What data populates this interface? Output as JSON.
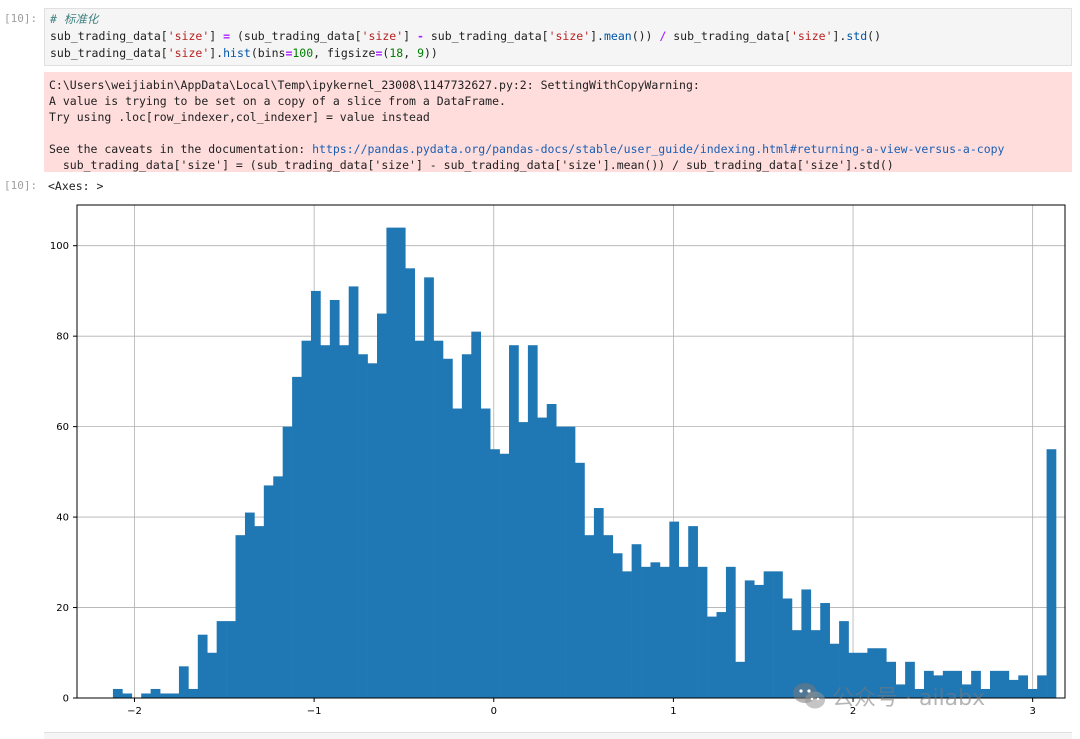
{
  "cell_in": {
    "prompt": "[10]:",
    "comment": "# 标准化",
    "line2": {
      "a": "sub_trading_data[",
      "s1": "'size'",
      "b": "] ",
      "eq": "=",
      "c": " (sub_trading_data[",
      "s2": "'size'",
      "d": "] ",
      "minus": "-",
      "e": " sub_trading_data[",
      "s3": "'size'",
      "f": "].",
      "mean": "mean",
      "g": "()) ",
      "div": "/",
      "h": " sub_trading_data[",
      "s4": "'size'",
      "i": "].",
      "std": "std",
      "j": "()"
    },
    "line3": {
      "a": "sub_trading_data[",
      "s1": "'size'",
      "b": "].",
      "hist": "hist",
      "c": "(bins",
      "eq1": "=",
      "n1": "100",
      "d": ", figsize",
      "eq2": "=",
      "e": "(",
      "n2": "18",
      "f": ", ",
      "n3": "9",
      "g": "))"
    }
  },
  "warning": {
    "line1": "C:\\Users\\weijiabin\\AppData\\Local\\Temp\\ipykernel_23008\\1147732627.py:2: SettingWithCopyWarning:",
    "line2": "A value is trying to be set on a copy of a slice from a DataFrame.",
    "line3": "Try using .loc[row_indexer,col_indexer] = value instead",
    "line4_prefix": "See the caveats in the documentation: ",
    "line4_link": "https://pandas.pydata.org/pandas-docs/stable/user_guide/indexing.html#returning-a-view-versus-a-copy",
    "line5": "  sub_trading_data['size'] = (sub_trading_data['size'] - sub_trading_data['size'].mean()) / sub_trading_data['size'].std()"
  },
  "cell_out": {
    "prompt": "[10]:",
    "text": "<Axes: >"
  },
  "watermark": {
    "text": "公众号 · ailabx",
    "icon": "wechat-icon"
  },
  "colors": {
    "bar": "#1f77b4",
    "grid": "#b0b0b0",
    "warning_bg": "#ffdddd"
  },
  "chart_data": {
    "type": "bar",
    "bins": 100,
    "xlim": [
      -2.32,
      3.18
    ],
    "ylim": [
      0,
      109
    ],
    "grid": true,
    "xticks": [
      -2,
      -1,
      0,
      1,
      2,
      3
    ],
    "xtick_labels": [
      "−2",
      "−1",
      "0",
      "1",
      "2",
      "3"
    ],
    "yticks": [
      0,
      20,
      40,
      60,
      80,
      100
    ],
    "ytick_labels": [
      "0",
      "20",
      "40",
      "60",
      "80",
      "100"
    ],
    "bin_start": -2.12,
    "bin_width": 0.0525,
    "values": [
      2,
      1,
      0,
      1,
      2,
      1,
      1,
      7,
      2,
      14,
      10,
      17,
      17,
      36,
      41,
      38,
      47,
      49,
      60,
      71,
      79,
      90,
      78,
      88,
      78,
      91,
      76,
      74,
      85,
      104,
      104,
      95,
      79,
      93,
      79,
      75,
      64,
      76,
      81,
      64,
      55,
      54,
      78,
      61,
      78,
      62,
      65,
      60,
      60,
      52,
      36,
      42,
      36,
      32,
      28,
      34,
      29,
      30,
      29,
      39,
      29,
      38,
      29,
      18,
      19,
      29,
      8,
      26,
      25,
      28,
      28,
      22,
      15,
      24,
      15,
      21,
      12,
      17,
      10,
      10,
      11,
      11,
      8,
      3,
      8,
      2,
      6,
      5,
      6,
      6,
      3,
      6,
      2,
      6,
      6,
      4,
      5,
      2,
      5,
      55
    ]
  }
}
